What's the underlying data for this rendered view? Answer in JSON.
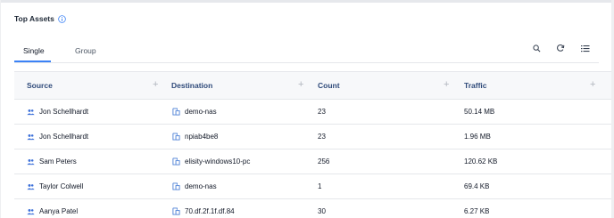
{
  "widget": {
    "title": "Top Assets"
  },
  "tabs": [
    {
      "label": "Single",
      "active": true
    },
    {
      "label": "Group",
      "active": false
    }
  ],
  "toolbar": {
    "icons": [
      "search-icon",
      "refresh-icon",
      "list-icon"
    ]
  },
  "table": {
    "columns": [
      "Source",
      "Destination",
      "Count",
      "Traffic"
    ],
    "rows": [
      {
        "source": "Jon Schellhardt",
        "destination": "demo-nas",
        "count": "23",
        "traffic": "50.14 MB"
      },
      {
        "source": "Jon Schellhardt",
        "destination": "npiab4be8",
        "count": "23",
        "traffic": "1.96 MB"
      },
      {
        "source": "Sam Peters",
        "destination": "elisity-windows10-pc",
        "count": "256",
        "traffic": "120.62 KB"
      },
      {
        "source": "Taylor Colwell",
        "destination": "demo-nas",
        "count": "1",
        "traffic": "69.4 KB"
      },
      {
        "source": "Aanya Patel",
        "destination": "70.df.2f.1f.df.84",
        "count": "30",
        "traffic": "6.27 KB"
      }
    ]
  },
  "colors": {
    "accent": "#3b82f6",
    "header_text": "#2f4a7a",
    "user_icon": "#3b6fd9",
    "asset_icon": "#4a7fd6"
  }
}
